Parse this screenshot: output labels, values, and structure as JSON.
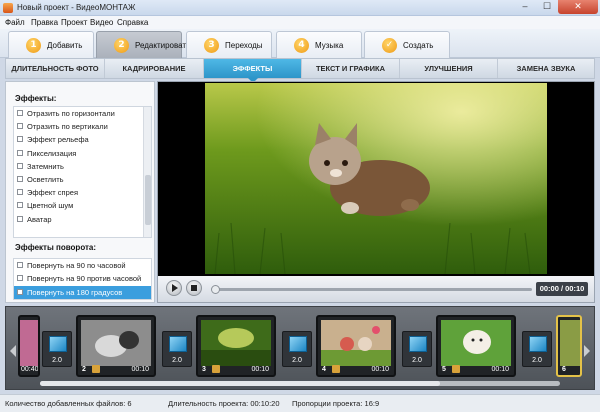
{
  "window": {
    "title": "Новый проект - ВидеоМОНТАЖ",
    "minimize": "–",
    "maximize": "☐",
    "close": "✕"
  },
  "menu": [
    "Файл",
    "Правка",
    "Проект",
    "Видео",
    "Справка"
  ],
  "steps": [
    {
      "num": "1",
      "label": "Добавить"
    },
    {
      "num": "2",
      "label": "Редактировать"
    },
    {
      "num": "3",
      "label": "Переходы"
    },
    {
      "num": "4",
      "label": "Музыка"
    },
    {
      "num": "✓",
      "label": "Создать"
    }
  ],
  "active_step": 1,
  "subtabs": [
    "ДЛИТЕЛЬНОСТЬ ФОТО",
    "КАДРИРОВАНИЕ",
    "ЭФФЕКТЫ",
    "ТЕКСТ И ГРАФИКА",
    "УЛУЧШЕНИЯ",
    "ЗАМЕНА ЗВУКА"
  ],
  "active_subtab": 2,
  "effects_panel": {
    "title": "Эффекты:",
    "items": [
      "Отразить по горизонтали",
      "Отразить по вертикали",
      "Эффект рельефа",
      "Пикселизация",
      "Затемнить",
      "Осветлить",
      "Эффект спрея",
      "Цветной шум",
      "Аватар"
    ]
  },
  "rotation_panel": {
    "title": "Эффекты поворота:",
    "items": [
      "Повернуть на 90 по часовой",
      "Повернуть на 90 против часовой",
      "Повернуть на 180 градусов"
    ],
    "selected": 2
  },
  "player": {
    "timecode": "00:00 / 00:10",
    "progress": 0
  },
  "timeline": {
    "first_partial_duration": "00:40",
    "clips": [
      {
        "num": "2",
        "duration": "00:10"
      },
      {
        "num": "3",
        "duration": "00:10"
      },
      {
        "num": "4",
        "duration": "00:10"
      },
      {
        "num": "5",
        "duration": "00:10"
      },
      {
        "num": "6",
        "duration": ""
      }
    ],
    "transitions": [
      "2.0",
      "2.0",
      "2.0",
      "2.0",
      "2.0"
    ]
  },
  "status": {
    "files": "Количество добавленных файлов: 6",
    "duration": "Длительность проекта: 00:10:20",
    "ratio": "Пропорции проекта: 16:9"
  },
  "colors": {
    "accent": "#2d95c9",
    "selection": "#3b9ede",
    "step_badge": "#ef9a14"
  }
}
